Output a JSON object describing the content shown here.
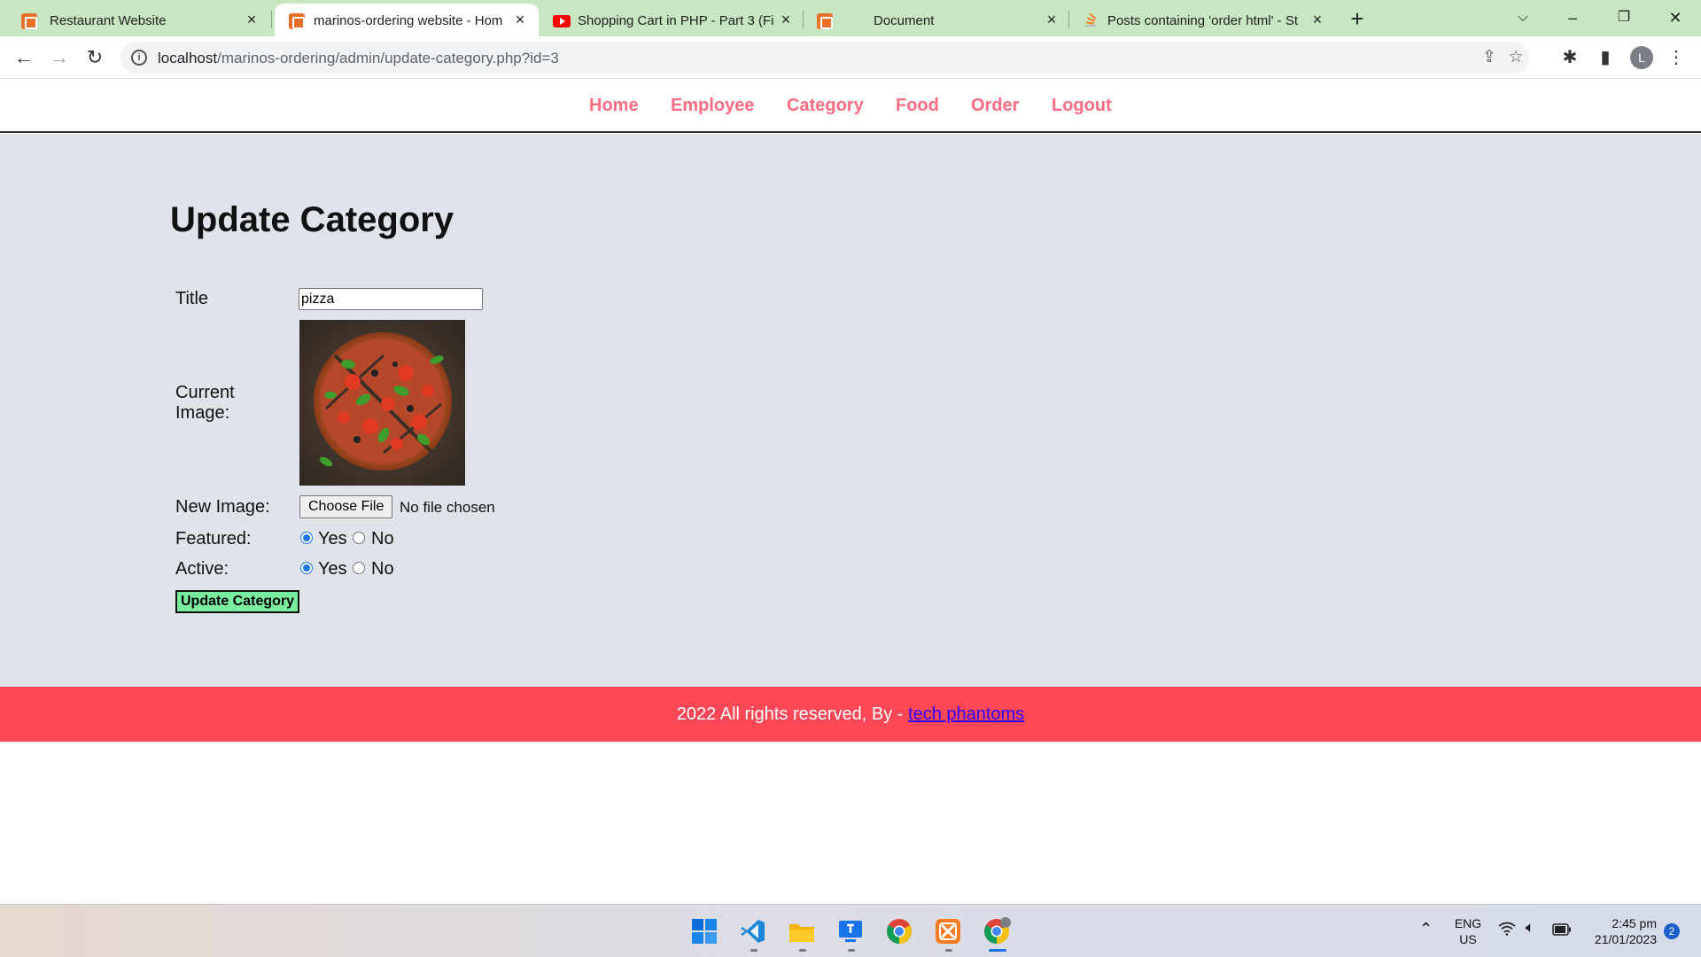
{
  "browser": {
    "tabs": [
      {
        "title": "Restaurant Website",
        "icon": "xampp-icon",
        "active": false
      },
      {
        "title": "marinos-ordering website - Hom",
        "icon": "xampp-icon",
        "active": true
      },
      {
        "title": "Shopping Cart in PHP - Part 3 (Fi",
        "icon": "youtube-icon",
        "active": false
      },
      {
        "title": "Document",
        "icon": "xampp-icon",
        "active": false
      },
      {
        "title": "Posts containing 'order html' - St",
        "icon": "stackoverflow-icon",
        "active": false
      }
    ],
    "url_host": "localhost",
    "url_path": "/marinos-ordering/admin/update-category.php?id=3",
    "profile_initial": "L"
  },
  "nav": {
    "items": [
      "Home",
      "Employee",
      "Category",
      "Food",
      "Order",
      "Logout"
    ],
    "color": "#ff6b81"
  },
  "form": {
    "heading": "Update Category",
    "title_label": "Title",
    "title_value": "pizza",
    "current_image_label": "Current Image:",
    "new_image_label": "New Image:",
    "choose_file_label": "Choose File",
    "no_file_text": "No file chosen",
    "featured_label": "Featured:",
    "active_label": "Active:",
    "yes_label": "Yes",
    "no_label": "No",
    "featured_value": "Yes",
    "active_value": "Yes",
    "submit_label": "Update Category"
  },
  "footer": {
    "text": "2022 All rights reserved, By - ",
    "link_text": "tech phantoms",
    "bg_color": "#ff4757"
  },
  "taskbar": {
    "lang_top": "ENG",
    "lang_bottom": "US",
    "time": "2:45 pm",
    "date": "21/01/2023",
    "notification_count": "2"
  }
}
